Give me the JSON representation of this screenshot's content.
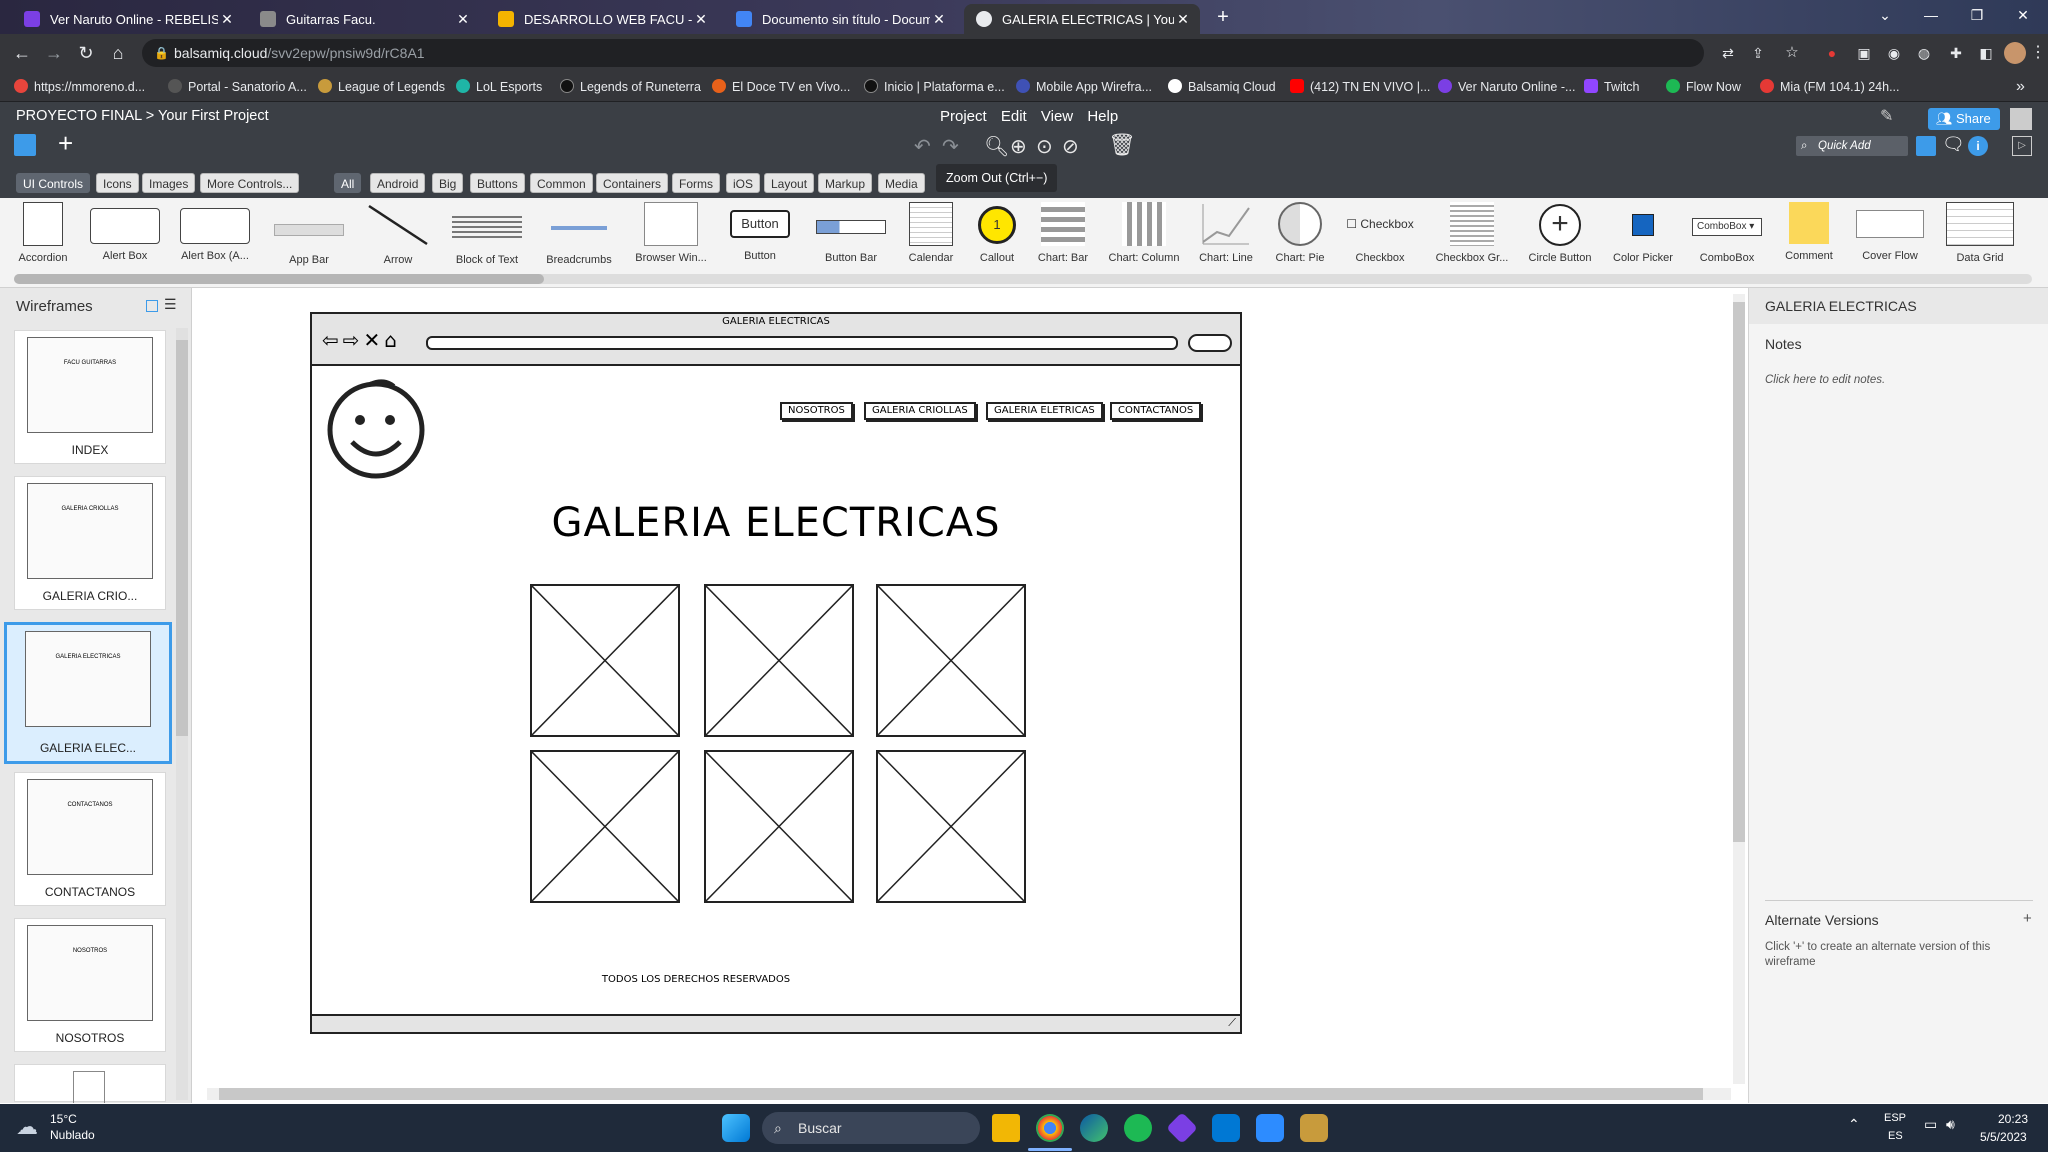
{
  "browser": {
    "tabs": [
      {
        "title": "Ver Naruto Online - REBELISPLUS",
        "color": "#7b3fe4"
      },
      {
        "title": "Guitarras Facu.",
        "color": "#8a8a8a"
      },
      {
        "title": "DESARROLLO WEB FACU - Goo",
        "color": "#f4b400"
      },
      {
        "title": "Documento sin título - Docum",
        "color": "#4285f4"
      },
      {
        "title": "GALERIA ELECTRICAS | Your First",
        "color": "#e8eaed"
      }
    ],
    "new_tab": "+",
    "address_host": "balsamiq.cloud",
    "address_path": "/svv2epw/pnsiw9d/rC8A1",
    "bookmarks": [
      {
        "label": "https://mmoreno.d...",
        "color": "#e8453c"
      },
      {
        "label": "Portal - Sanatorio A...",
        "color": "#555"
      },
      {
        "label": "League of Legends",
        "color": "#c89b3c"
      },
      {
        "label": "LoL Esports",
        "color": "#1fb5a6"
      },
      {
        "label": "Legends of Runeterra",
        "color": "#222"
      },
      {
        "label": "El Doce TV en Vivo...",
        "color": "#e8611a"
      },
      {
        "label": "Inicio | Plataforma e...",
        "color": "#222"
      },
      {
        "label": "Mobile App Wirefra...",
        "color": "#3f51b5"
      },
      {
        "label": "Balsamiq Cloud",
        "color": "#fff"
      },
      {
        "label": "(412) TN EN VIVO |...",
        "color": "#ff0000"
      },
      {
        "label": "Ver Naruto Online -...",
        "color": "#7b3fe4"
      },
      {
        "label": "Twitch",
        "color": "#9146ff"
      },
      {
        "label": "Flow Now",
        "color": "#1db954"
      },
      {
        "label": "Mia (FM 104.1) 24h...",
        "color": "#e53935"
      }
    ],
    "more": "»"
  },
  "app": {
    "breadcrumb_project": "PROYECTO FINAL",
    "breadcrumb_sep": ">",
    "breadcrumb_file": "Your First Project",
    "menu": [
      "Project",
      "Edit",
      "View",
      "Help"
    ],
    "share_label": "Share",
    "quick_add_placeholder": "Quick Add",
    "tooltip": "Zoom Out (Ctrl+−)",
    "ui_tabs": [
      "UI Controls",
      "Icons",
      "Images",
      "More Controls..."
    ],
    "filters": [
      "All",
      "Android",
      "Big",
      "Buttons",
      "Common",
      "Containers",
      "Forms",
      "iOS",
      "Layout",
      "Markup",
      "Media"
    ],
    "library": [
      "Accordion",
      "Alert Box",
      "Alert Box (A...",
      "App Bar",
      "Arrow",
      "Block of Text",
      "Breadcrumbs",
      "Browser Win...",
      "Button",
      "Button Bar",
      "Calendar",
      "Callout",
      "Chart: Bar",
      "Chart: Column",
      "Chart: Line",
      "Chart: Pie",
      "Checkbox",
      "Checkbox Gr...",
      "Circle Button",
      "Color Picker",
      "ComboBox",
      "Comment",
      "Cover Flow",
      "Data Grid"
    ],
    "library_button_text": "Button",
    "library_checkbox_text": "Checkbox",
    "library_combobox_text": "ComboBox",
    "library_callout_text": "1"
  },
  "wireframes": {
    "title": "Wireframes",
    "items": [
      {
        "label": "INDEX",
        "mini_title": "FACU GUITARRAS"
      },
      {
        "label": "GALERIA CRIO...",
        "mini_title": "GALERIA CRIOLLAS"
      },
      {
        "label": "GALERIA ELEC...",
        "mini_title": "GALERIA ELECTRICAS"
      },
      {
        "label": "CONTACTANOS",
        "mini_title": "CONTACTANOS"
      },
      {
        "label": "NOSOTROS",
        "mini_title": "NOSOTROS"
      }
    ]
  },
  "mock": {
    "window_title": "GALERIA ELECTRICAS",
    "nav": [
      "NOSOTROS",
      "GALERIA CRIOLLAS",
      "GALERIA ELETRICAS",
      "CONTACTANOS"
    ],
    "heading": "GALERIA ELECTRICAS",
    "footer": "TODOS LOS DERECHOS RESERVADOS"
  },
  "inspector": {
    "title": "GALERIA ELECTRICAS",
    "notes_label": "Notes",
    "notes_hint": "Click here to edit notes.",
    "alt_title": "Alternate Versions",
    "alt_add": "+",
    "alt_hint": "Click '+' to create an alternate version of this wireframe"
  },
  "taskbar": {
    "weather_temp": "15°C",
    "weather_desc": "Nublado",
    "search_placeholder": "Buscar",
    "lang_top": "ESP",
    "lang_bottom": "ES",
    "time": "20:23",
    "date": "5/5/2023"
  }
}
